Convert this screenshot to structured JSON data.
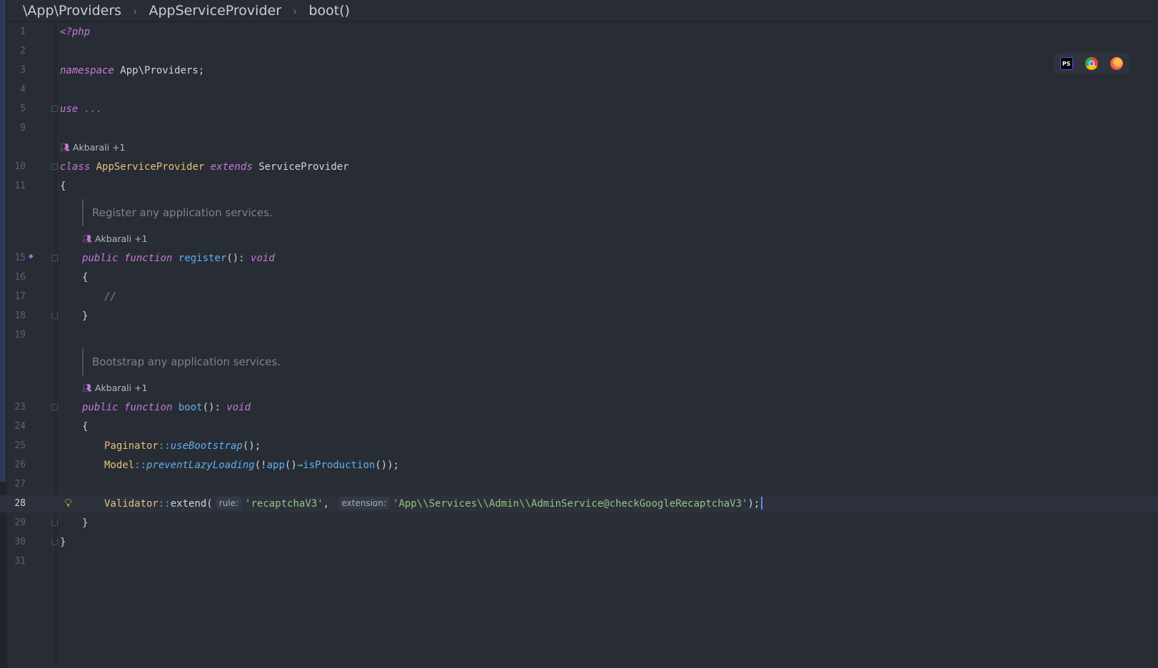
{
  "breadcrumb": [
    "\\App\\Providers",
    "AppServiceProvider",
    "boot()"
  ],
  "author": "Akbarali +1",
  "doc_comments": [
    "Register any application services.",
    "Bootstrap any application services."
  ],
  "lines": {
    "l1": {
      "num": "1",
      "php_open": "<?php"
    },
    "l2": {
      "num": "2"
    },
    "l3": {
      "num": "3",
      "kw": "namespace",
      "rest": " App\\Providers;"
    },
    "l4": {
      "num": "4"
    },
    "l5": {
      "num": "5",
      "kw": "use",
      "rest": " ..."
    },
    "l9": {
      "num": "9"
    },
    "l10": {
      "num": "10",
      "kw1": "class",
      "name": "AppServiceProvider",
      "kw2": "extends",
      "parent": "ServiceProvider"
    },
    "l11": {
      "num": "11",
      "text": "{"
    },
    "l15": {
      "num": "15",
      "kw1": "public",
      "kw2": "function",
      "fn": "register",
      "paren": "(): ",
      "type": "void"
    },
    "l16": {
      "num": "16",
      "text": "{"
    },
    "l17": {
      "num": "17",
      "comment": "//"
    },
    "l18": {
      "num": "18",
      "text": "}"
    },
    "l19": {
      "num": "19"
    },
    "l23": {
      "num": "23",
      "kw1": "public",
      "kw2": "function",
      "fn": "boot",
      "paren": "(): ",
      "type": "void"
    },
    "l24": {
      "num": "24",
      "text": "{"
    },
    "l25": {
      "num": "25",
      "cls": "Paginator",
      "sep": "::",
      "method": "useBootstrap",
      "end": "();"
    },
    "l26": {
      "num": "26",
      "cls": "Model",
      "sep": "::",
      "method": "preventLazyLoading",
      "a": "(!",
      "fn": "app",
      "b": "()",
      "arrow": "→",
      "fn2": "isProduction",
      "end": "());"
    },
    "l27": {
      "num": "27"
    },
    "l28": {
      "num": "28",
      "cls": "Validator",
      "sep": "::",
      "method": "extend",
      "open": "(",
      "hint1": "rule:",
      "str1": "'recaptchaV3'",
      "comma": ",",
      "hint2": "extension:",
      "str2": "'App\\\\Services\\\\Admin\\\\AdminService@checkGoogleRecaptchaV3'",
      "end": ");"
    },
    "l29": {
      "num": "29",
      "text": "}"
    },
    "l30": {
      "num": "30",
      "text": "}"
    },
    "l31": {
      "num": "31"
    }
  },
  "icons": {
    "bulb": "lightbulb-icon",
    "ps": "PS"
  },
  "colors": {
    "background": "#282c34",
    "keyword": "#c678dd",
    "class": "#e5c07b",
    "function": "#61afef",
    "string": "#98c379",
    "caret": "#5c8df6"
  }
}
